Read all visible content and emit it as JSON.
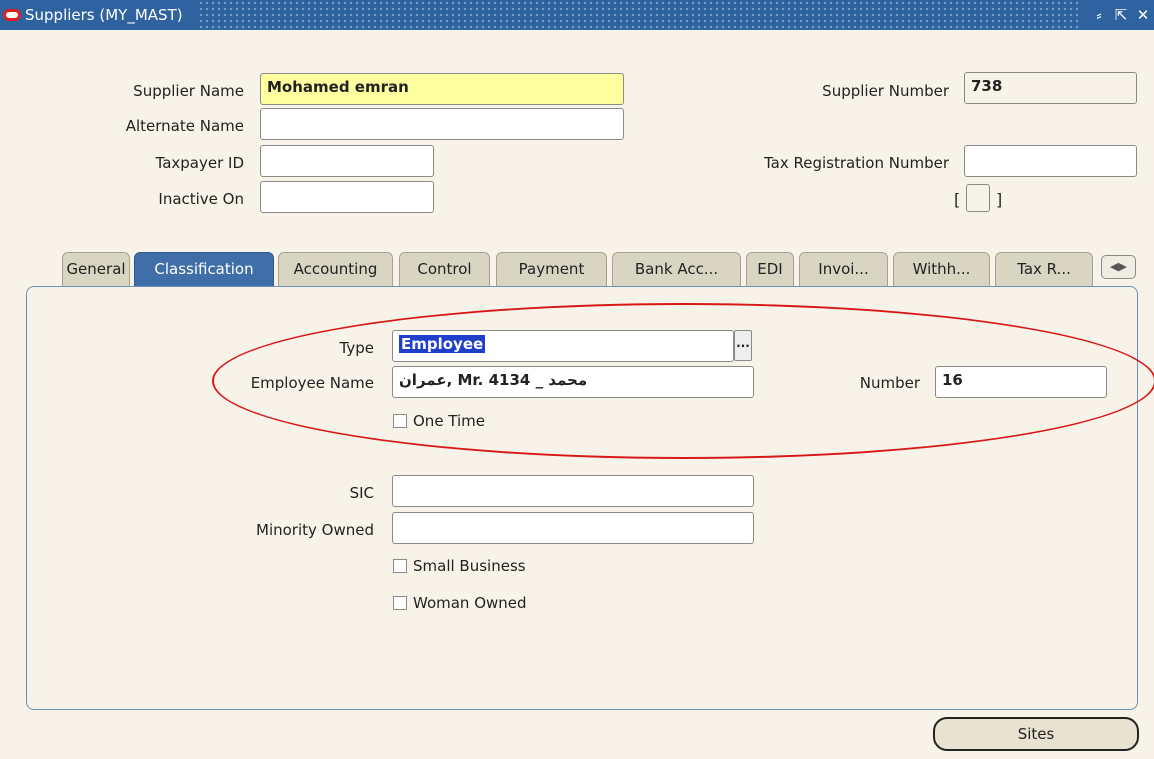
{
  "window": {
    "title": "Suppliers (MY_MAST)",
    "buttons": [
      "minimize-icon",
      "maximize-icon",
      "close-icon"
    ]
  },
  "header": {
    "supplier_name_label": "Supplier Name",
    "supplier_name_value": "Mohamed emran",
    "alternate_name_label": "Alternate Name",
    "alternate_name_value": "",
    "taxpayer_id_label": "Taxpayer ID",
    "taxpayer_id_value": "",
    "inactive_on_label": "Inactive On",
    "inactive_on_value": "",
    "supplier_number_label": "Supplier Number",
    "supplier_number_value": "738",
    "tax_reg_label": "Tax Registration Number",
    "tax_reg_value": "",
    "bracket_open": "[",
    "bracket_close": "]"
  },
  "tabs": [
    {
      "label": "General"
    },
    {
      "label": "Classification",
      "active": true
    },
    {
      "label": "Accounting"
    },
    {
      "label": "Control"
    },
    {
      "label": "Payment"
    },
    {
      "label": "Bank Acc..."
    },
    {
      "label": "EDI"
    },
    {
      "label": "Invoi..."
    },
    {
      "label": "Withh..."
    },
    {
      "label": "Tax R..."
    }
  ],
  "classification": {
    "type_label": "Type",
    "type_value": "Employee",
    "lov_button": "...",
    "employee_name_label": "Employee Name",
    "employee_name_value": "عمران, Mr. 4134 _ محمد",
    "number_label": "Number",
    "number_value": "16",
    "one_time_label": "One Time",
    "sic_label": "SIC",
    "sic_value": "",
    "minority_owned_label": "Minority Owned",
    "minority_owned_value": "",
    "small_business_label": "Small Business",
    "woman_owned_label": "Woman Owned"
  },
  "footer": {
    "sites_button": "Sites"
  },
  "colors": {
    "background": "#f7f3e8",
    "titlebar": "#2f63a0",
    "active_tab": "#3f6ea8",
    "required_field": "#ffffa0",
    "annotation": "#d81818"
  }
}
